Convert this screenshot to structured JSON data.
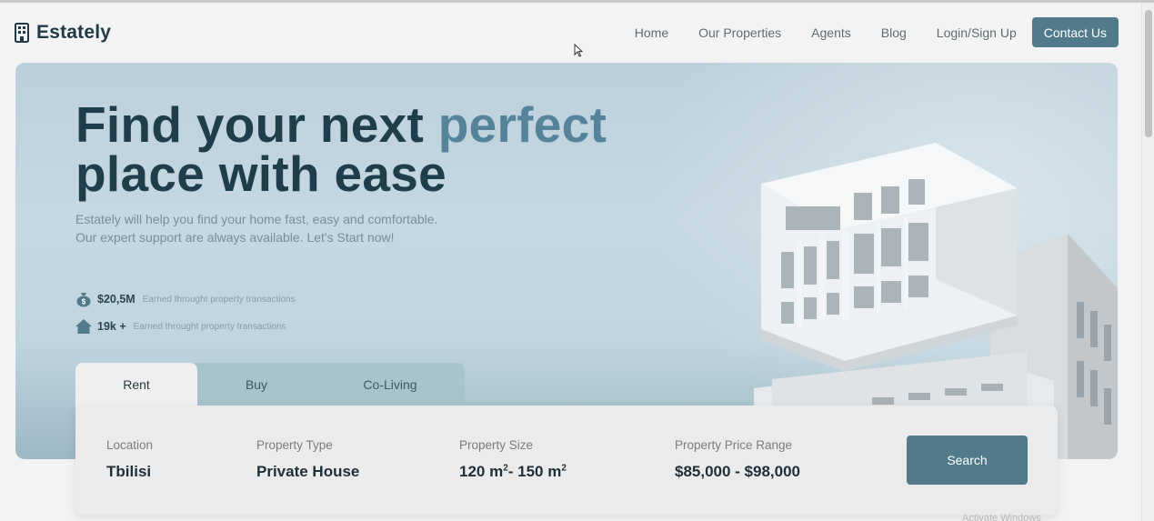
{
  "brand": {
    "name": "Estately",
    "icon": "building-icon"
  },
  "nav": {
    "links": [
      "Home",
      "Our Properties",
      "Agents",
      "Blog",
      "Login/Sign Up"
    ],
    "cta": "Contact Us"
  },
  "hero": {
    "title_part1": "Find your next ",
    "title_accent": "perfect",
    "title_part2": "place with ease",
    "subtitle_line1": "Estately will help you find your home fast, easy and comfortable.",
    "subtitle_line2": "Our expert support are always available. Let's Start now!",
    "stats": [
      {
        "icon": "money-bag-icon",
        "value": "$20,5M",
        "desc": "Earned throught property transactions"
      },
      {
        "icon": "house-icon",
        "value": "19k +",
        "desc": "Earned throught property transactions"
      }
    ]
  },
  "tabs": [
    "Rent",
    "Buy",
    "Co-Living"
  ],
  "search": {
    "location_label": "Location",
    "location_value": "Tbilisi",
    "type_label": "Property Type",
    "type_value": "Private House",
    "size_label": "Property Size",
    "size_value_a": "120 m",
    "size_value_b": "- 150 m",
    "size_exp": "2",
    "price_label": "Property Price Range",
    "price_value": "$85,000 - $98,000",
    "button": "Search"
  },
  "watermark": "Activate Windows",
  "colors": {
    "accent": "#517b8b",
    "heading": "#1f3e4c",
    "heading_accent": "#55849a"
  }
}
